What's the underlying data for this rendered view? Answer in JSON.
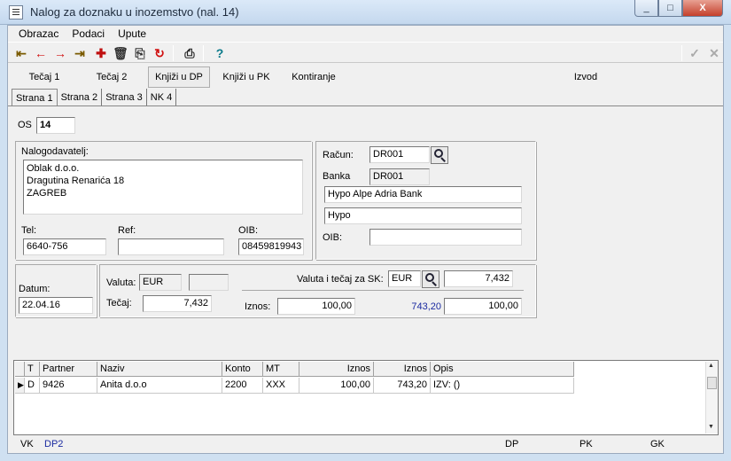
{
  "window": {
    "title": "Nalog za doznaku u inozemstvo (nal. 14)",
    "min": "_",
    "max": "□",
    "close": "X"
  },
  "menu": [
    "Obrazac",
    "Podaci",
    "Upute"
  ],
  "toolbar": {
    "help": "?"
  },
  "actions": {
    "tecaj1": "Tečaj 1",
    "tecaj2": "Tečaj 2",
    "knjizi_dp": "Knjiži u DP",
    "knjizi_pk": "Knjiži u PK",
    "kontiranje": "Kontiranje",
    "izvod": "Izvod"
  },
  "tabs": [
    "Strana 1",
    "Strana 2",
    "Strana 3",
    "NK 4"
  ],
  "os": {
    "label": "OS",
    "value": "14"
  },
  "nalogodavatelj": {
    "label": "Nalogodavatelj:",
    "lines": [
      "Oblak d.o.o.",
      "Dragutina Renarića 18",
      "ZAGREB"
    ]
  },
  "tel": {
    "label": "Tel:",
    "value": "6640-756"
  },
  "ref": {
    "label": "Ref:",
    "value": ""
  },
  "oib": {
    "label": "OIB:",
    "value": "08459819943"
  },
  "racun": {
    "label": "Račun:",
    "value": "DR001"
  },
  "banka": {
    "label": "Banka",
    "value": "DR001",
    "name": "Hypo Alpe Adria Bank",
    "short": "Hypo"
  },
  "oib2": {
    "label": "OIB:",
    "value": ""
  },
  "datum": {
    "label": "Datum:",
    "value": "22.04.16"
  },
  "valuta": {
    "label": "Valuta:",
    "value": "EUR",
    "extra": ""
  },
  "tecaj": {
    "label": "Tečaj:",
    "value": "7,432"
  },
  "valuta_sk": {
    "label": "Valuta i tečaj za SK:",
    "value": "EUR",
    "rate": "7,432"
  },
  "iznos": {
    "label": "Iznos:",
    "value": "100,00",
    "converted": "743,20",
    "value2": "100,00"
  },
  "grid": {
    "headers": [
      "T",
      "Partner",
      "Naziv",
      "Konto",
      "MT",
      "Iznos",
      "Iznos",
      "Opis"
    ],
    "rows": [
      [
        "D",
        "9426",
        "Anita d.o.o",
        "2200",
        "XXX",
        "100,00",
        "743,20",
        "IZV: ()"
      ]
    ]
  },
  "status": {
    "vk": "VK",
    "dp2": "DP2",
    "dp": "DP",
    "pk": "PK",
    "gk": "GK"
  }
}
